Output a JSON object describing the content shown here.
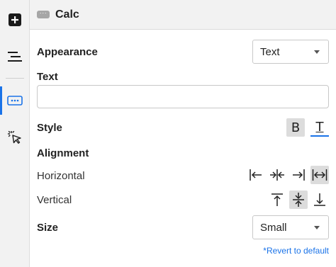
{
  "rail": {
    "items": [
      {
        "icon": "plus-square-icon"
      },
      {
        "icon": "menu-lines-icon"
      },
      {
        "icon": "ellipsis-box-icon",
        "active": true
      },
      {
        "icon": "cursor-click-icon"
      }
    ]
  },
  "header": {
    "chip": "···",
    "title": "Calc"
  },
  "appearance": {
    "label": "Appearance",
    "value": "Text"
  },
  "text": {
    "label": "Text",
    "value": "",
    "placeholder": ""
  },
  "style": {
    "label": "Style",
    "bold_glyph": "B",
    "underline_glyph": "T"
  },
  "alignment": {
    "label": "Alignment",
    "horizontal": {
      "label": "Horizontal",
      "options": [
        "align-left",
        "align-center",
        "align-right",
        "stretch"
      ],
      "selected": "stretch"
    },
    "vertical": {
      "label": "Vertical",
      "options": [
        "align-top",
        "align-middle",
        "align-bottom"
      ],
      "selected": "align-middle"
    }
  },
  "size": {
    "label": "Size",
    "value": "Small"
  },
  "revert_label": "*Revert to default",
  "colors": {
    "accent": "#1a73e8",
    "selected_bg": "#dcdcdc",
    "rail_bg": "#f2f2f2"
  }
}
